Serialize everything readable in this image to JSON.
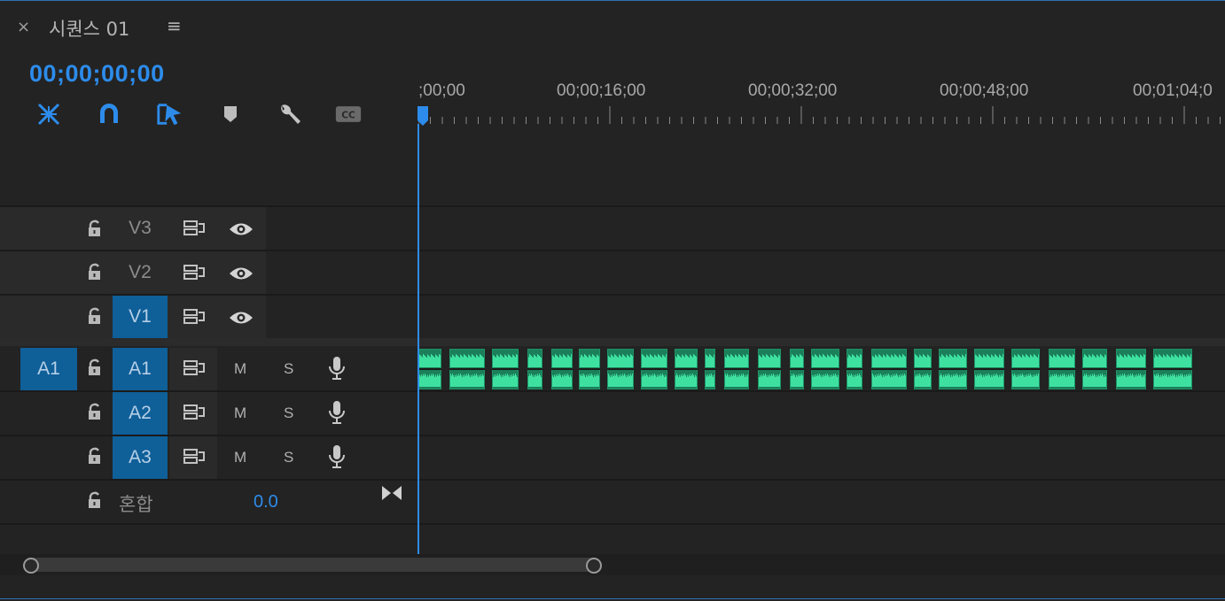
{
  "panel": {
    "close_label": "×",
    "title": "시퀀스 01",
    "menu_label": "≡"
  },
  "timecode": "00;00;00;00",
  "ruler": {
    "labels": [
      ";00;00",
      "00;00;16;00",
      "00;00;32;00",
      "00;00;48;00",
      "00;01;04;0"
    ]
  },
  "tracks": {
    "video": [
      {
        "name": "V3",
        "targeted": false
      },
      {
        "name": "V2",
        "targeted": false
      },
      {
        "name": "V1",
        "targeted": true
      }
    ],
    "audio": [
      {
        "name": "A1",
        "source": "A1",
        "targeted": true
      },
      {
        "name": "A2",
        "targeted": true
      },
      {
        "name": "A3",
        "targeted": true
      }
    ],
    "mute_label": "M",
    "solo_label": "S",
    "mix": {
      "label": "혼합",
      "value": "0.0"
    }
  },
  "colors": {
    "accent": "#2d8ceb",
    "track_target": "#0f5f99",
    "audio_clip": "#1e9468",
    "waveform": "#3ee0a0"
  },
  "icons": [
    "snap-icon",
    "magnet-icon",
    "linked-selection-icon",
    "marker-icon",
    "wrench-icon",
    "closed-caption-icon",
    "lock-icon",
    "sync-lock-icon",
    "eye-icon",
    "microphone-icon",
    "bowtie-icon"
  ]
}
